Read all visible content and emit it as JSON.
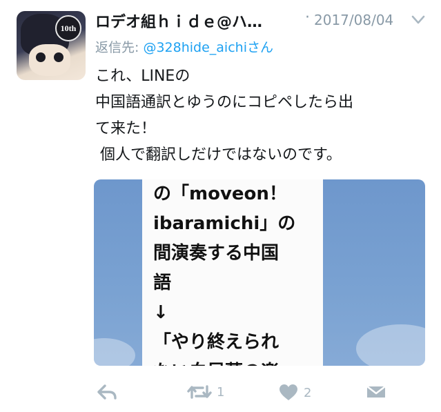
{
  "tweet": {
    "display_name": "ロデオ組ｈｉｄｅ@ハ…",
    "dot": "·",
    "date": "2017/08/04",
    "reply_prefix": "返信先: ",
    "reply_handle": "@328hide_aichiさん",
    "text_lines": [
      "これ、LINEの",
      "中国語通訳とゆうのにコピペしたら出",
      "て来た！",
      " 個人で翻訳しだけではないのです。"
    ]
  },
  "avatar": {
    "badge_text": "10th",
    "icon": "avatar-image"
  },
  "media": {
    "lines": [
      "の「moveon！",
      "ibaramichi」の",
      "間演奏する中国",
      "語",
      "↓",
      "「やり終えられ",
      "ない白昼夢の楽"
    ]
  },
  "actions": {
    "reply": {
      "icon": "reply-icon"
    },
    "retweet": {
      "icon": "retweet-icon",
      "count": "1"
    },
    "like": {
      "icon": "heart-icon",
      "count": "2"
    },
    "dm": {
      "icon": "envelope-icon"
    }
  },
  "colors": {
    "text": "#14171a",
    "muted": "#8899a6",
    "link": "#1da1f2",
    "action_gray": "#aab8c2",
    "sky_blue": "#7aa2d2"
  }
}
